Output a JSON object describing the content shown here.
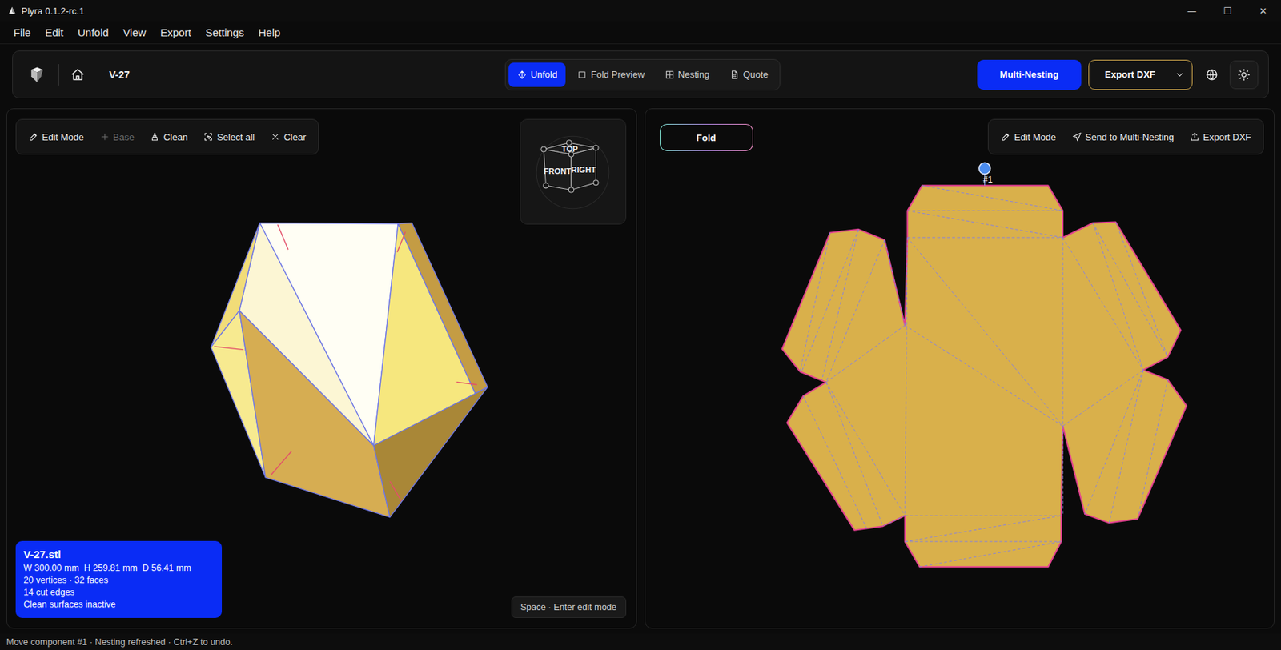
{
  "window": {
    "title": "Plyra 0.1.2-rc.1",
    "controls": [
      "—",
      "☐",
      "✕"
    ]
  },
  "menu": [
    "File",
    "Edit",
    "Unfold",
    "View",
    "Export",
    "Settings",
    "Help"
  ],
  "toolbar": {
    "project": "V-27",
    "tabs": [
      {
        "label": "Unfold",
        "selected": true
      },
      {
        "label": "Fold Preview",
        "selected": false
      },
      {
        "label": "Nesting",
        "selected": false
      },
      {
        "label": "Quote",
        "selected": false
      }
    ],
    "multi_nesting": "Multi-Nesting",
    "export": "Export DXF"
  },
  "model_panel": {
    "tools": [
      {
        "label": "Edit Mode",
        "disabled": false
      },
      {
        "label": "Base",
        "disabled": true
      },
      {
        "label": "Clean",
        "disabled": false
      },
      {
        "label": "Select all",
        "disabled": false
      },
      {
        "label": "Clear",
        "disabled": false
      }
    ],
    "view_cube": {
      "top": "TOP",
      "front": "FRONT",
      "right": "RIGHT"
    },
    "info": {
      "file": "V-27.stl",
      "dimensions": "W 300.00 mm  H 259.81 mm  D 56.41 mm",
      "counts": "20 vertices · 32 faces",
      "cut_edges": "14 cut edges",
      "clean": "Clean surfaces inactive"
    },
    "hint": "Space · Enter edit mode"
  },
  "net_panel": {
    "fold": "Fold",
    "tools": [
      "Edit Mode",
      "Send to Multi-Nesting",
      "Export DXF"
    ],
    "component": "#1"
  },
  "status_bar": "Move component #1 · Nesting refreshed · Ctrl+Z to undo."
}
